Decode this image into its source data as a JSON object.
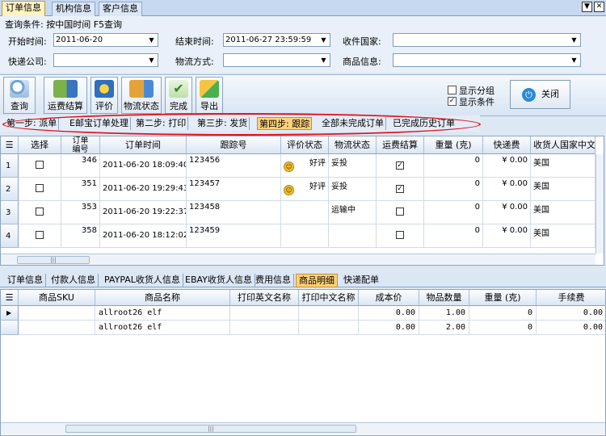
{
  "tabs": [
    "订单信息",
    "机构信息",
    "客户信息"
  ],
  "window_buttons": [
    "▼",
    "✕"
  ],
  "query": {
    "title": "查询条件: 按中国时间  F5查询",
    "start_label": "开始时间:",
    "start_value": "2011-06-20",
    "end_label": "结束时间:",
    "end_value": "2011-06-27 23:59:59",
    "country_label": "收件国家:",
    "country_value": "",
    "courier_label": "快递公司:",
    "courier_value": "",
    "logistics_label": "物流方式:",
    "logistics_value": "",
    "product_label": "商品信息:",
    "product_value": ""
  },
  "toolbar": {
    "buttons": [
      "查询",
      "运费结算",
      "评价",
      "物流状态",
      "完成",
      "导出"
    ],
    "show_group_label": "显示分组",
    "show_group_checked": false,
    "show_cond_label": "显示条件",
    "show_cond_checked": true,
    "close_label": "关闭"
  },
  "steps": [
    "第一步: 派单",
    "E邮宝订单处理",
    "第二步: 打印",
    "第三步: 发货",
    "第四步: 跟踪",
    "全部未完成订单",
    "已完成历史订单"
  ],
  "active_step": 4,
  "orders": {
    "columns": [
      "选择",
      "订单\n编号",
      "订单时间",
      "跟踪号",
      "评价状态",
      "物流状态",
      "运费结算",
      "重量 (克)",
      "快递费",
      "收货人国家中文"
    ],
    "rows": [
      {
        "num": "1",
        "checked": false,
        "id": "346",
        "time": "2011-06-20 18:09:40",
        "tracking": "123456",
        "rating": "好评",
        "has_icon": true,
        "logistics": "妥投",
        "freight": true,
        "weight": "0",
        "fee": "¥ 0.00",
        "country": "美国"
      },
      {
        "num": "2",
        "checked": false,
        "id": "351",
        "time": "2011-06-20 19:29:43",
        "tracking": "123457",
        "rating": "好评",
        "has_icon": true,
        "logistics": "妥投",
        "freight": true,
        "weight": "0",
        "fee": "¥ 0.00",
        "country": "美国"
      },
      {
        "num": "3",
        "checked": false,
        "id": "353",
        "time": "2011-06-20 19:22:37",
        "tracking": "123458",
        "rating": "",
        "has_icon": false,
        "logistics": "运输中",
        "freight": false,
        "weight": "0",
        "fee": "¥ 0.00",
        "country": "美国"
      },
      {
        "num": "4",
        "checked": false,
        "id": "358",
        "time": "2011-06-20 18:12:02",
        "tracking": "123459",
        "rating": "",
        "has_icon": false,
        "logistics": "",
        "freight": false,
        "weight": "0",
        "fee": "¥ 0.00",
        "country": "美国"
      }
    ]
  },
  "bottom_tabs": [
    "订单信息",
    "付款人信息",
    "PAYPAL收货人信息",
    "EBAY收货人信息",
    "费用信息",
    "商品明细",
    "快递配单"
  ],
  "active_bottom_tab": 5,
  "items": {
    "columns": [
      "商品SKU",
      "商品名称",
      "打印英文名称",
      "打印中文名称",
      "成本价",
      "物品数量",
      "重量 (克)",
      "手续费"
    ],
    "rows": [
      {
        "sku": "",
        "name": "allroot26 elf",
        "print_en": "",
        "print_cn": "",
        "cost": "0.00",
        "qty": "1.00",
        "weight": "0",
        "fee": "0.00"
      },
      {
        "sku": "",
        "name": "allroot26 elf",
        "print_en": "",
        "print_cn": "",
        "cost": "0.00",
        "qty": "2.00",
        "weight": "0",
        "fee": "0.00"
      }
    ]
  }
}
